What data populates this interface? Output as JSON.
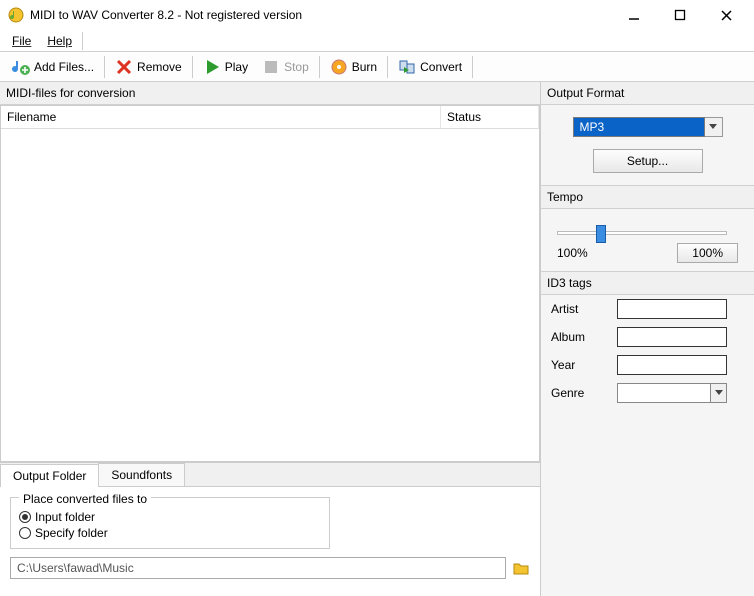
{
  "titlebar": {
    "text": "MIDI to WAV Converter 8.2 - Not registered version"
  },
  "menu": {
    "file": "File",
    "help": "Help"
  },
  "toolbar": {
    "add": "Add Files...",
    "remove": "Remove",
    "play": "Play",
    "stop": "Stop",
    "burn": "Burn",
    "convert": "Convert"
  },
  "left": {
    "header": "MIDI-files for conversion",
    "col_filename": "Filename",
    "col_status": "Status",
    "tabs": {
      "output": "Output Folder",
      "soundfonts": "Soundfonts"
    },
    "place_legend": "Place converted files to",
    "radio_input": "Input folder",
    "radio_specify": "Specify folder",
    "path": "C:\\Users\\fawad\\Music"
  },
  "right": {
    "format_header": "Output Format",
    "format_value": "MP3",
    "setup": "Setup...",
    "tempo_header": "Tempo",
    "tempo_min": "100%",
    "tempo_reset": "100%",
    "id3_header": "ID3 tags",
    "artist_label": "Artist",
    "album_label": "Album",
    "year_label": "Year",
    "genre_label": "Genre"
  }
}
